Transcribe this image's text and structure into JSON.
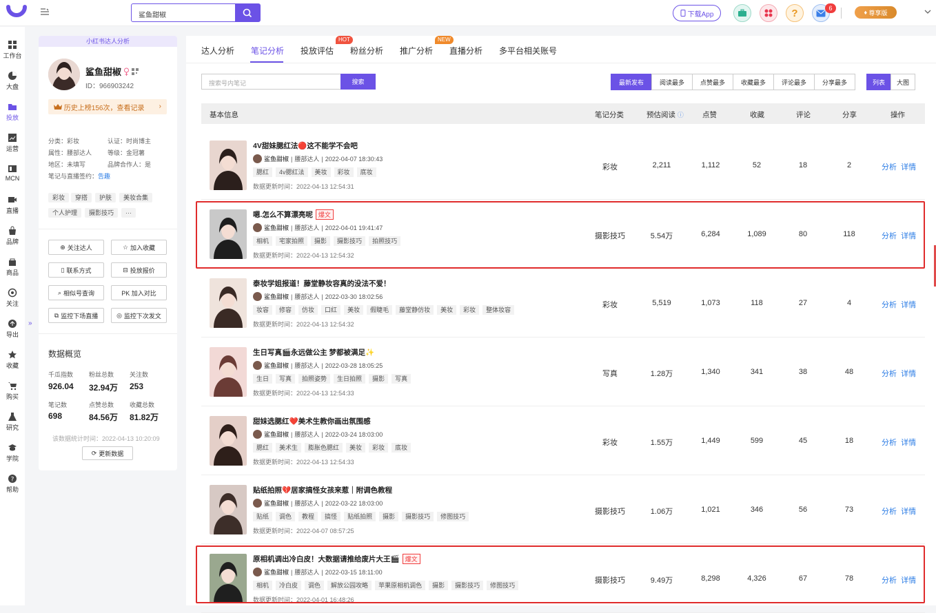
{
  "search": {
    "value": "鲨鱼甜椒"
  },
  "topbar": {
    "download_app": "下载App",
    "mail_count": "6",
    "vip_label": "尊享版"
  },
  "leftnav": [
    {
      "label": "工作台",
      "icon": "grid-icon"
    },
    {
      "label": "大盘",
      "icon": "pie-icon"
    },
    {
      "label": "投放",
      "icon": "folder-icon"
    },
    {
      "label": "运营",
      "icon": "chart-icon"
    },
    {
      "label": "MCN",
      "icon": "mcn-icon"
    },
    {
      "label": "直播",
      "icon": "video-icon"
    },
    {
      "label": "品牌",
      "icon": "bag-icon"
    },
    {
      "label": "商品",
      "icon": "cart-bag-icon"
    },
    {
      "label": "关注",
      "icon": "eye-icon"
    },
    {
      "label": "导出",
      "icon": "export-icon"
    },
    {
      "label": "收藏",
      "icon": "star-icon"
    },
    {
      "label": "购买",
      "icon": "cart-icon"
    },
    {
      "label": "研究",
      "icon": "flask-icon"
    },
    {
      "label": "学院",
      "icon": "graduation-icon"
    },
    {
      "label": "帮助",
      "icon": "help-icon"
    }
  ],
  "profile": {
    "banner": "小红书达人分析",
    "name": "鲨鱼甜椒",
    "id": "ID：966903242",
    "history": "历史上榜156次，查看记录",
    "category_label": "分类：",
    "category": "彩妆",
    "cert_label": "认证：",
    "cert": "时尚博主",
    "attr_label": "属性：",
    "attr": "腰部达人",
    "level_label": "等级：",
    "level": "金冠薯",
    "region_label": "地区：",
    "region": "未填写",
    "brand_label": "品牌合作人：",
    "brand": "是",
    "sign_label": "笔记与直播签约：",
    "sign": "告趣",
    "tags": [
      "彩妆",
      "穿搭",
      "护肤",
      "美妆合集",
      "个人护理",
      "摄影技巧",
      "···"
    ],
    "buttons": [
      "关注达人",
      "加入收藏",
      "联系方式",
      "投放报价",
      "相似号查询",
      "PK 加入对比",
      "监控下场直播",
      "监控下次发文"
    ],
    "overview_title": "数据概览",
    "stats": [
      {
        "label": "千瓜指数",
        "value": "926.04"
      },
      {
        "label": "粉丝总数",
        "value": "32.94万"
      },
      {
        "label": "关注数",
        "value": "253"
      },
      {
        "label": "笔记数",
        "value": "698"
      },
      {
        "label": "点赞总数",
        "value": "84.56万"
      },
      {
        "label": "收藏总数",
        "value": "81.82万"
      }
    ],
    "stat_time": "该数据统计时间：2022-04-13 10:20:09",
    "refresh": "更新数据"
  },
  "tabs": [
    {
      "label": "达人分析"
    },
    {
      "label": "笔记分析"
    },
    {
      "label": "投放评估",
      "badge": "HOT"
    },
    {
      "label": "粉丝分析"
    },
    {
      "label": "推广分析",
      "badge": "NEW"
    },
    {
      "label": "直播分析"
    },
    {
      "label": "多平台相关账号"
    }
  ],
  "note_search": {
    "placeholder": "搜索号内笔记",
    "button": "搜索"
  },
  "sort_options": [
    "最新发布",
    "阅读最多",
    "点赞最多",
    "收藏最多",
    "评论最多",
    "分享最多"
  ],
  "view_options": [
    "列表",
    "大图"
  ],
  "table": {
    "headers": [
      "基本信息",
      "笔记分类",
      "预估阅读",
      "点赞",
      "收藏",
      "评论",
      "分享",
      "操作"
    ],
    "update_prefix": "数据更新时间：",
    "action_analyze": "分析",
    "action_detail": "详情",
    "rows": [
      {
        "title": "4V甜妹腮红法🔴这不能学不会吧",
        "boom": "",
        "author": "鲨鱼甜椒",
        "level": "腰部达人",
        "time": "2022-04-07 18:30:43",
        "tags": [
          "腮红",
          "4v腮红法",
          "美妆",
          "彩妆",
          "底妆"
        ],
        "updated": "2022-04-13 12:54:31",
        "category": "彩妆",
        "reads": "2,211",
        "likes": "1,112",
        "favs": "52",
        "comments": "18",
        "shares": "2",
        "highlight": false
      },
      {
        "title": "嗯.怎么不算漂亮呢",
        "boom": "爆文",
        "author": "鲨鱼甜椒",
        "level": "腰部达人",
        "time": "2022-04-01 19:41:47",
        "tags": [
          "相机",
          "宅家拍照",
          "摄影",
          "摄影技巧",
          "拍照技巧"
        ],
        "updated": "2022-04-13 12:54:32",
        "category": "摄影技巧",
        "reads": "5.54万",
        "likes": "6,284",
        "favs": "1,089",
        "comments": "80",
        "shares": "118",
        "highlight": true
      },
      {
        "title": "泰妆学姐报道！藤堂静妆容真的没法不爱！",
        "boom": "",
        "author": "鲨鱼甜椒",
        "level": "腰部达人",
        "time": "2022-03-30 18:02:56",
        "tags": [
          "妆容",
          "修容",
          "仿妆",
          "口红",
          "美妆",
          "假睫毛",
          "藤堂静仿妆",
          "美妆",
          "彩妆",
          "整体妆容"
        ],
        "updated": "2022-04-13 12:54:32",
        "category": "彩妆",
        "reads": "5,519",
        "likes": "1,073",
        "favs": "118",
        "comments": "27",
        "shares": "4",
        "highlight": false
      },
      {
        "title": "生日写真🎬永远做公主 梦都被满足✨",
        "boom": "",
        "author": "鲨鱼甜椒",
        "level": "腰部达人",
        "time": "2022-03-28 18:05:25",
        "tags": [
          "生日",
          "写真",
          "拍照姿势",
          "生日拍照",
          "摄影",
          "写真"
        ],
        "updated": "2022-04-13 12:54:33",
        "category": "写真",
        "reads": "1.28万",
        "likes": "1,340",
        "favs": "341",
        "comments": "38",
        "shares": "48",
        "highlight": false
      },
      {
        "title": "甜妹选腮红❤️美术生教你画出氛围感",
        "boom": "",
        "author": "鲨鱼甜椒",
        "level": "腰部达人",
        "time": "2022-03-24 18:03:00",
        "tags": [
          "腮红",
          "美术生",
          "膨胀色腮红",
          "美妆",
          "彩妆",
          "底妆"
        ],
        "updated": "2022-04-13 12:54:33",
        "category": "彩妆",
        "reads": "1.55万",
        "likes": "1,449",
        "favs": "599",
        "comments": "45",
        "shares": "18",
        "highlight": false
      },
      {
        "title": "贴纸拍照💔居家搞怪女孩来惹｜附调色教程",
        "boom": "",
        "author": "鲨鱼甜椒",
        "level": "腰部达人",
        "time": "2022-03-22 18:03:00",
        "tags": [
          "贴纸",
          "调色",
          "教程",
          "搞怪",
          "贴纸拍照",
          "摄影",
          "摄影技巧",
          "修图技巧"
        ],
        "updated": "2022-04-07 08:57:25",
        "category": "摄影技巧",
        "reads": "1.06万",
        "likes": "1,021",
        "favs": "346",
        "comments": "56",
        "shares": "73",
        "highlight": false
      },
      {
        "title": "原相机调出冷白皮！大数据请推给废片大王🎬",
        "boom": "爆文",
        "author": "鲨鱼甜椒",
        "level": "腰部达人",
        "time": "2022-03-15 18:11:00",
        "tags": [
          "相机",
          "冷白皮",
          "调色",
          "解放公园攻略",
          "苹果原相机调色",
          "摄影",
          "摄影技巧",
          "修图技巧"
        ],
        "updated": "2022-04-01 16:48:26",
        "category": "摄影技巧",
        "reads": "9.49万",
        "likes": "8,298",
        "favs": "4,326",
        "comments": "67",
        "shares": "78",
        "highlight": true
      }
    ]
  },
  "colors": {
    "accent": "#6b52e6",
    "link": "#2b7ce5",
    "highlight": "#e02b2b"
  }
}
